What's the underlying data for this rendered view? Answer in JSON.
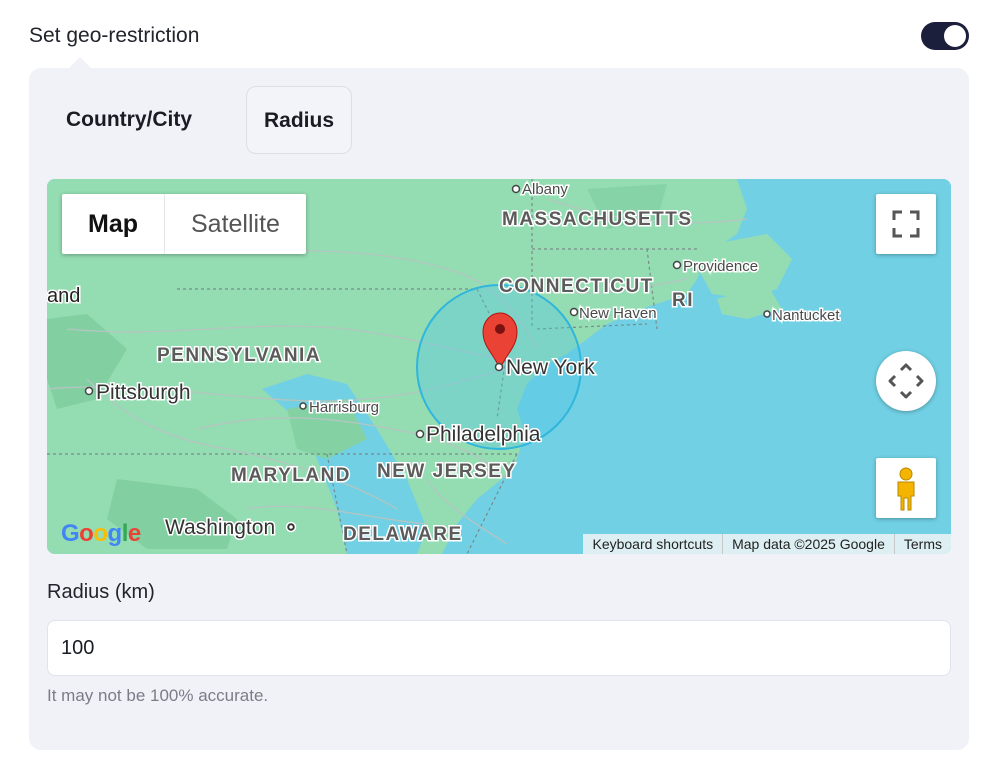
{
  "header": {
    "label": "Set geo-restriction",
    "toggle_on": true
  },
  "tabs": {
    "country_city": "Country/City",
    "radius": "Radius"
  },
  "map": {
    "type_map": "Map",
    "type_satellite": "Satellite",
    "labels": {
      "albany": "Albany",
      "massachusetts": "MASSACHUSETTS",
      "connecticut": "CONNECTICUT",
      "ri": "RI",
      "providence": "Providence",
      "new_haven": "New Haven",
      "nantucket": "Nantucket",
      "land": "and",
      "pennsylvania": "PENNSYLVANIA",
      "new_york": "New York",
      "pittsburgh": "Pittsburgh",
      "harrisburg": "Harrisburg",
      "philadelphia": "Philadelphia",
      "maryland": "MARYLAND",
      "new_jersey": "NEW JERSEY",
      "washington": "Washington",
      "delaware": "DELAWARE"
    },
    "logo": "Google",
    "attribution": {
      "keyboard": "Keyboard shortcuts",
      "mapdata": "Map data ©2025 Google",
      "terms": "Terms"
    },
    "icons": {
      "fullscreen": "fullscreen-icon",
      "move": "camera-move-icon",
      "pegman": "pegman-icon",
      "marker": "map-marker-icon"
    }
  },
  "radius": {
    "label": "Radius (km)",
    "value": "100",
    "help": "It may not be 100% accurate."
  },
  "colors": {
    "toggle": "#1b1f3b",
    "panel": "#f1f2f8",
    "water": "#71d0e4",
    "land": "#94dcb2",
    "radius_circle": "#4cc6e8",
    "marker": "#ea4335"
  }
}
